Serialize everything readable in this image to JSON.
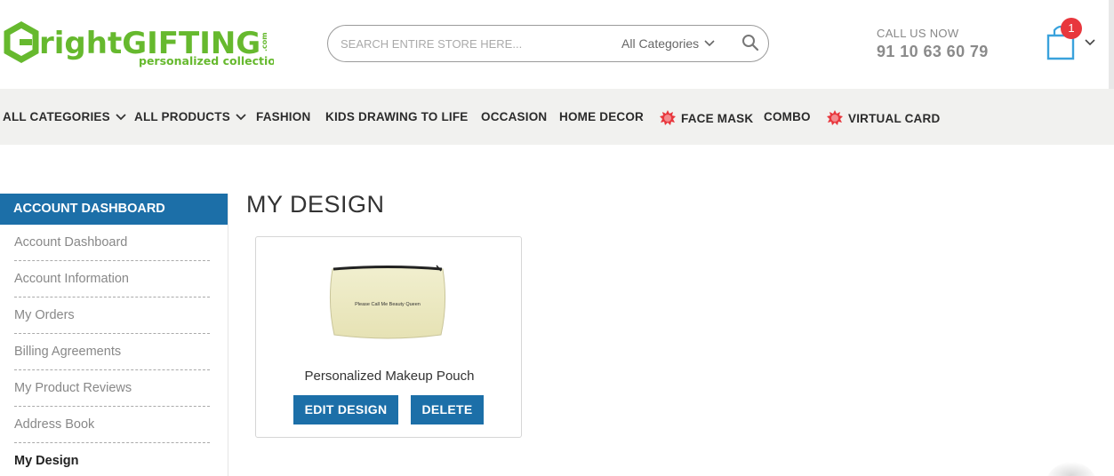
{
  "header": {
    "logo_main": "rightGIFTING",
    "logo_sub": "personalized collection",
    "logo_com": ".com",
    "search_placeholder": "SEARCH ENTIRE STORE HERE...",
    "category_select": "All Categories",
    "call_label": "CALL US NOW",
    "call_number": "91 10 63 60 79",
    "cart_count": "1"
  },
  "nav": {
    "items": [
      {
        "label": "ALL CATEGORIES",
        "chevron": true,
        "new": false
      },
      {
        "label": "ALL PRODUCTS",
        "chevron": true,
        "new": false
      },
      {
        "label": "FASHION",
        "chevron": false,
        "new": false
      },
      {
        "label": "KIDS DRAWING TO LIFE",
        "chevron": false,
        "new": false
      },
      {
        "label": "OCCASION",
        "chevron": false,
        "new": false
      },
      {
        "label": "HOME DECOR",
        "chevron": false,
        "new": false
      },
      {
        "label": "FACE MASK",
        "chevron": false,
        "new": true
      },
      {
        "label": "COMBO",
        "chevron": false,
        "new": false
      },
      {
        "label": "VIRTUAL CARD",
        "chevron": false,
        "new": true
      }
    ]
  },
  "sidebar": {
    "title": "ACCOUNT DASHBOARD",
    "items": [
      {
        "label": "Account Dashboard"
      },
      {
        "label": "Account Information"
      },
      {
        "label": "My Orders"
      },
      {
        "label": "Billing Agreements"
      },
      {
        "label": "My Product Reviews"
      },
      {
        "label": "Address Book"
      },
      {
        "label": "My Design"
      }
    ],
    "active_index": 6
  },
  "main": {
    "title": "MY DESIGN",
    "product": {
      "name": "Personalized Makeup Pouch",
      "print_text": "Please Call Me Beauty Queen",
      "edit_label": "EDIT DESIGN",
      "delete_label": "DELETE"
    }
  },
  "colors": {
    "brand_green": "#66b92e",
    "accent_blue": "#1c6fa8",
    "badge_red": "#e8373d",
    "nav_bg": "#f1f1ef",
    "cart_blue": "#3aa2dc"
  },
  "icons": [
    "search-icon",
    "cart-icon",
    "chevron-down-icon",
    "new-badge-icon"
  ]
}
